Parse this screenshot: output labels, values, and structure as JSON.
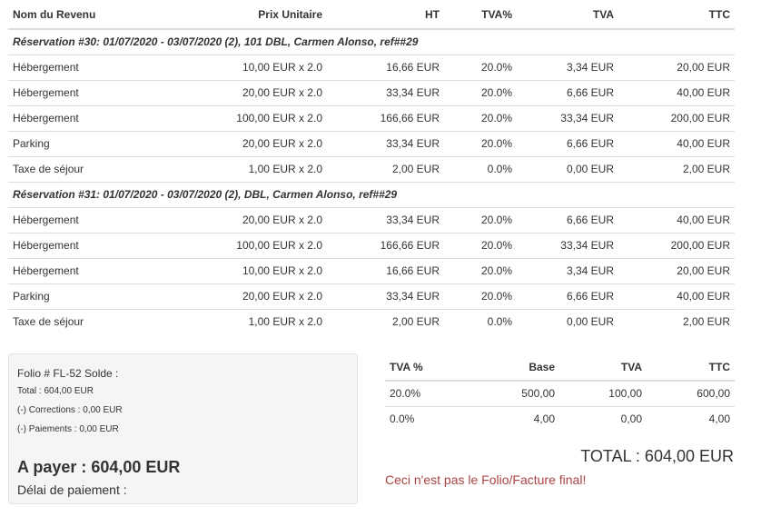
{
  "headers": {
    "name": "Nom du Revenu",
    "unit_price": "Prix Unitaire",
    "ht": "HT",
    "tva_pct": "TVA%",
    "tva": "TVA",
    "ttc": "TTC"
  },
  "groups": [
    {
      "title": "Réservation #30: 01/07/2020 - 03/07/2020 (2), 101 DBL, Carmen Alonso, ref##29",
      "rows": [
        {
          "name": "Hébergement",
          "unit": "10,00 EUR x 2.0",
          "ht": "16,66 EUR",
          "pct": "20.0%",
          "tva": "3,34 EUR",
          "ttc": "20,00 EUR"
        },
        {
          "name": "Hébergement",
          "unit": "20,00 EUR x 2.0",
          "ht": "33,34 EUR",
          "pct": "20.0%",
          "tva": "6,66 EUR",
          "ttc": "40,00 EUR"
        },
        {
          "name": "Hébergement",
          "unit": "100,00 EUR x 2.0",
          "ht": "166,66 EUR",
          "pct": "20.0%",
          "tva": "33,34 EUR",
          "ttc": "200,00 EUR"
        },
        {
          "name": "Parking",
          "unit": "20,00 EUR x 2.0",
          "ht": "33,34 EUR",
          "pct": "20.0%",
          "tva": "6,66 EUR",
          "ttc": "40,00 EUR"
        },
        {
          "name": "Taxe de séjour",
          "unit": "1,00 EUR x 2.0",
          "ht": "2,00 EUR",
          "pct": "0.0%",
          "tva": "0,00 EUR",
          "ttc": "2,00 EUR"
        }
      ]
    },
    {
      "title": "Réservation #31: 01/07/2020 - 03/07/2020 (2), DBL, Carmen Alonso, ref##29",
      "rows": [
        {
          "name": "Hébergement",
          "unit": "20,00 EUR x 2.0",
          "ht": "33,34 EUR",
          "pct": "20.0%",
          "tva": "6,66 EUR",
          "ttc": "40,00 EUR"
        },
        {
          "name": "Hébergement",
          "unit": "100,00 EUR x 2.0",
          "ht": "166,66 EUR",
          "pct": "20.0%",
          "tva": "33,34 EUR",
          "ttc": "200,00 EUR"
        },
        {
          "name": "Hébergement",
          "unit": "10,00 EUR x 2.0",
          "ht": "16,66 EUR",
          "pct": "20.0%",
          "tva": "3,34 EUR",
          "ttc": "20,00 EUR"
        },
        {
          "name": "Parking",
          "unit": "20,00 EUR x 2.0",
          "ht": "33,34 EUR",
          "pct": "20.0%",
          "tva": "6,66 EUR",
          "ttc": "40,00 EUR"
        },
        {
          "name": "Taxe de séjour",
          "unit": "1,00 EUR x 2.0",
          "ht": "2,00 EUR",
          "pct": "0.0%",
          "tva": "0,00 EUR",
          "ttc": "2,00 EUR"
        }
      ]
    }
  ],
  "folio": {
    "title": "Folio # FL-52 Solde :",
    "total": "Total : 604,00 EUR",
    "corrections": "(-) Corrections : 0,00 EUR",
    "payments": "(-) Paiements : 0,00 EUR",
    "to_pay": "A payer : 604,00 EUR",
    "payment_delay": "Délai de paiement :"
  },
  "tva_summary": {
    "headers": {
      "pct": "TVA %",
      "base": "Base",
      "tva": "TVA",
      "ttc": "TTC"
    },
    "rows": [
      {
        "pct": "20.0%",
        "base": "500,00",
        "tva": "100,00",
        "ttc": "600,00"
      },
      {
        "pct": "0.0%",
        "base": "4,00",
        "tva": "0,00",
        "ttc": "4,00"
      }
    ]
  },
  "total": "TOTAL : 604,00 EUR",
  "warning": "Ceci n'est pas le Folio/Facture final!",
  "colors": {
    "warning": "#a94442",
    "folio_bg": "#f5f5f5",
    "border": "#dddddd"
  }
}
